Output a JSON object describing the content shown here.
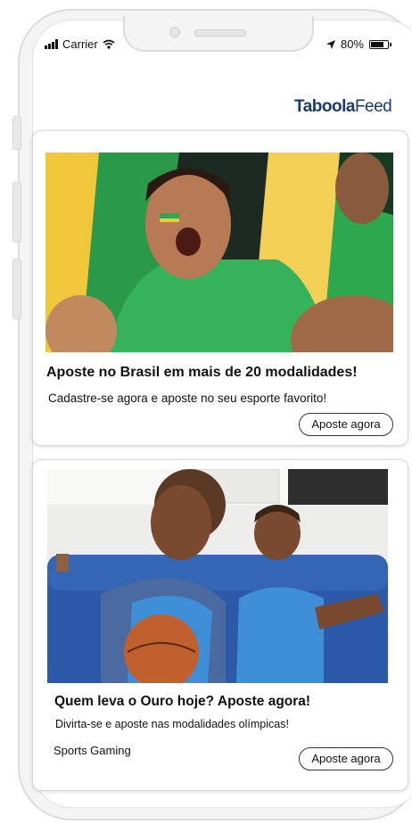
{
  "status_bar": {
    "carrier": "Carrier",
    "battery": "80%",
    "battery_level": 0.8
  },
  "brand": {
    "name_bold": "Taboola",
    "name_light": "Feed"
  },
  "cards": [
    {
      "title": "Aposte no Brasil em mais de 20 modalidades!",
      "description": "Cadastre-se agora e aposte no seu esporte favorito!",
      "button_label": "Aposte agora",
      "image_icon": "football-fans-photo"
    },
    {
      "title": "Quem leva o Ouro hoje? Aposte agora!",
      "description": "Divirta-se e aposte nas modalidades olímpicas!",
      "source": "Sports Gaming",
      "button_label": "Aposte agora",
      "image_icon": "family-basketball-photo"
    }
  ],
  "colors": {
    "brand": "#1a3a6e",
    "fan_green": "#2ea84f",
    "fan_yellow": "#f0c63a",
    "sofa_blue": "#2d5aa8"
  }
}
